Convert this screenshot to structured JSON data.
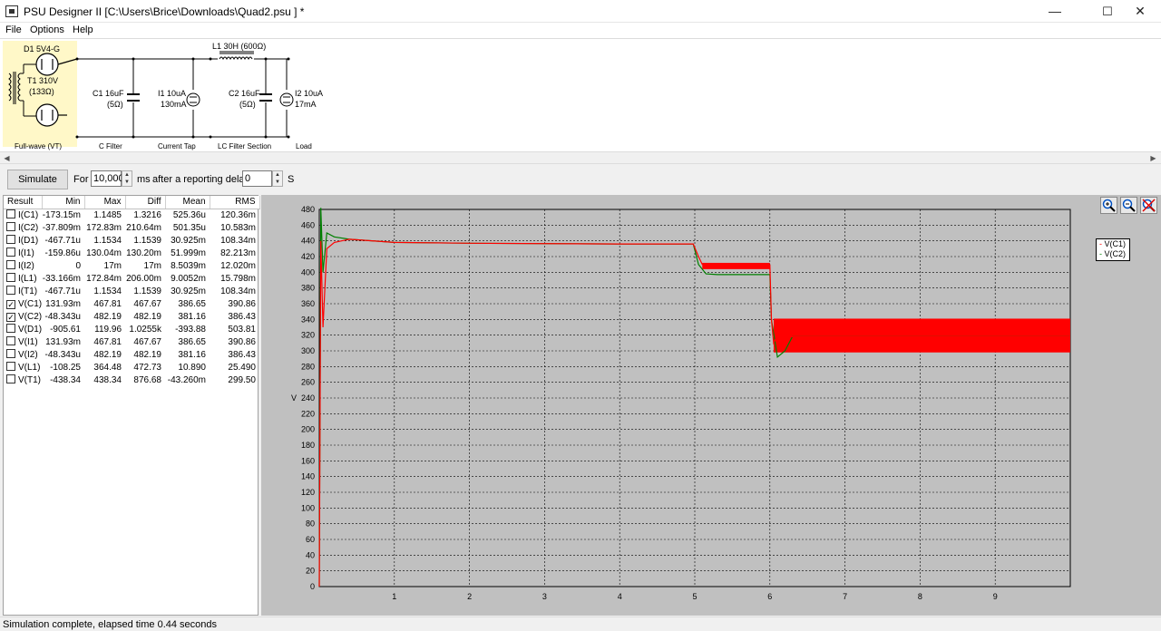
{
  "window": {
    "title": "PSU Designer II  [C:\\Users\\Brice\\Downloads\\Quad2.psu ] *",
    "minimize": "—",
    "maximize": "☐",
    "close": "✕"
  },
  "menu": {
    "file": "File",
    "options": "Options",
    "help": "Help"
  },
  "schematic": {
    "d1": "D1 5V4-G",
    "t1": "T1 310V",
    "t1_r": "(133Ω)",
    "c1": "C1 16uF",
    "c1_r": "(5Ω)",
    "i1": "I1 10uA",
    "i1_val": "130mA",
    "l1": "L1 30H (600Ω)",
    "c2": "C2 16uF",
    "c2_r": "(5Ω)",
    "i2": "I2 10uA",
    "i2_val": "17mA",
    "sec_fullwave": "Full-wave (VT)",
    "sec_cfilter": "C Filter",
    "sec_currenttap": "Current Tap",
    "sec_lcfilter": "LC Filter Section",
    "sec_load": "Load",
    "highlight_color": "#fff8c8"
  },
  "sim": {
    "button": "Simulate",
    "for_label": "For",
    "duration": "10,000",
    "ms_label": "ms",
    "delay_label": "after a reporting delay of",
    "delay": "0",
    "s_label": "S"
  },
  "results": {
    "headers": [
      "Result",
      "Min",
      "Max",
      "Diff",
      "Mean",
      "RMS"
    ],
    "rows": [
      {
        "checked": false,
        "name": "I(C1)",
        "min": "-173.15m",
        "max": "1.1485",
        "diff": "1.3216",
        "mean": "525.36u",
        "rms": "120.36m"
      },
      {
        "checked": false,
        "name": "I(C2)",
        "min": "-37.809m",
        "max": "172.83m",
        "diff": "210.64m",
        "mean": "501.35u",
        "rms": "10.583m"
      },
      {
        "checked": false,
        "name": "I(D1)",
        "min": "-467.71u",
        "max": "1.1534",
        "diff": "1.1539",
        "mean": "30.925m",
        "rms": "108.34m"
      },
      {
        "checked": false,
        "name": "I(I1)",
        "min": "-159.86u",
        "max": "130.04m",
        "diff": "130.20m",
        "mean": "51.999m",
        "rms": "82.213m"
      },
      {
        "checked": false,
        "name": "I(I2)",
        "min": "0",
        "max": "17m",
        "diff": "17m",
        "mean": "8.5039m",
        "rms": "12.020m"
      },
      {
        "checked": false,
        "name": "I(L1)",
        "min": "-33.166m",
        "max": "172.84m",
        "diff": "206.00m",
        "mean": "9.0052m",
        "rms": "15.798m"
      },
      {
        "checked": false,
        "name": "I(T1)",
        "min": "-467.71u",
        "max": "1.1534",
        "diff": "1.1539",
        "mean": "30.925m",
        "rms": "108.34m"
      },
      {
        "checked": true,
        "name": "V(C1)",
        "min": "131.93m",
        "max": "467.81",
        "diff": "467.67",
        "mean": "386.65",
        "rms": "390.86"
      },
      {
        "checked": true,
        "name": "V(C2)",
        "min": "-48.343u",
        "max": "482.19",
        "diff": "482.19",
        "mean": "381.16",
        "rms": "386.43"
      },
      {
        "checked": false,
        "name": "V(D1)",
        "min": "-905.61",
        "max": "119.96",
        "diff": "1.0255k",
        "mean": "-393.88",
        "rms": "503.81"
      },
      {
        "checked": false,
        "name": "V(I1)",
        "min": "131.93m",
        "max": "467.81",
        "diff": "467.67",
        "mean": "386.65",
        "rms": "390.86"
      },
      {
        "checked": false,
        "name": "V(I2)",
        "min": "-48.343u",
        "max": "482.19",
        "diff": "482.19",
        "mean": "381.16",
        "rms": "386.43"
      },
      {
        "checked": false,
        "name": "V(L1)",
        "min": "-108.25",
        "max": "364.48",
        "diff": "472.73",
        "mean": "10.890",
        "rms": "25.490"
      },
      {
        "checked": false,
        "name": "V(T1)",
        "min": "-438.34",
        "max": "438.34",
        "diff": "876.68",
        "mean": "-43.260m",
        "rms": "299.50"
      }
    ]
  },
  "tools": {
    "zoom_in": "zoom-in-icon",
    "zoom_out": "zoom-out-icon",
    "zoom_reset": "zoom-reset-icon"
  },
  "chart_data": {
    "type": "line",
    "ylabel": "V",
    "xlabel": "",
    "xlim": [
      0,
      10
    ],
    "ylim": [
      0,
      480
    ],
    "x_ticks": [
      "1",
      "2",
      "3",
      "4",
      "5",
      "6",
      "7",
      "8",
      "9"
    ],
    "y_ticks": [
      "0",
      "20",
      "40",
      "60",
      "80",
      "100",
      "120",
      "140",
      "160",
      "180",
      "200",
      "220",
      "240",
      "260",
      "280",
      "300",
      "320",
      "340",
      "360",
      "380",
      "400",
      "420",
      "440",
      "460",
      "480"
    ],
    "grid": true,
    "legend_position": "right",
    "series": [
      {
        "name": "V(C1)",
        "color": "#ff0000",
        "x": [
          0,
          0.02,
          0.05,
          0.1,
          0.2,
          0.4,
          1,
          2,
          4,
          4.98,
          5.05,
          5.1,
          5.2,
          6.0,
          6.02,
          6.05,
          6.1,
          6.2,
          7,
          8,
          10
        ],
        "y": [
          0,
          440,
          330,
          430,
          438,
          442,
          438,
          437,
          436,
          436,
          420,
          410,
          409,
          409,
          340,
          310,
          320,
          318,
          318,
          318,
          318
        ],
        "ripple_bands": [
          {
            "x_start": 5.1,
            "x_end": 6.0,
            "low": 404,
            "high": 412
          },
          {
            "x_start": 6.05,
            "x_end": 10,
            "low": 298,
            "high": 341
          }
        ]
      },
      {
        "name": "V(C2)",
        "color": "#008000",
        "x": [
          0,
          0.02,
          0.05,
          0.1,
          0.2,
          0.4,
          1,
          2,
          4,
          4.98,
          5.05,
          5.15,
          5.3,
          6.0,
          6.02,
          6.1,
          6.2,
          6.3,
          7,
          8,
          10
        ],
        "y": [
          0,
          482,
          400,
          450,
          445,
          442,
          438,
          437,
          436,
          436,
          410,
          398,
          397,
          397,
          340,
          292,
          300,
          318,
          318,
          318,
          318
        ]
      }
    ]
  },
  "status": {
    "text": "Simulation complete, elapsed time 0.44 seconds"
  }
}
